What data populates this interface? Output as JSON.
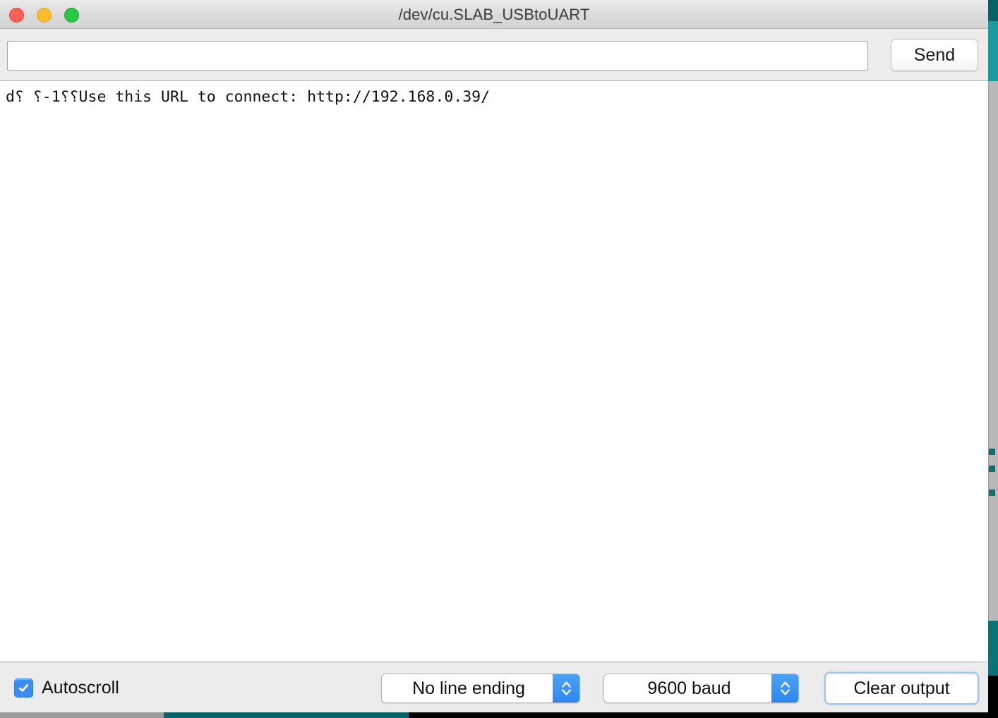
{
  "window": {
    "title": "/dev/cu.SLAB_USBtoUART",
    "traffic_lights": [
      {
        "name": "close",
        "color": "#ff5f57"
      },
      {
        "name": "minimize",
        "color": "#febc2e"
      },
      {
        "name": "maximize",
        "color": "#28c840"
      }
    ]
  },
  "send_row": {
    "input_value": "",
    "input_placeholder": "",
    "send_label": "Send"
  },
  "output": {
    "text": "d⸮ ⸮-1⸮⸮Use this URL to connect: http://192.168.0.39/"
  },
  "bottom_bar": {
    "autoscroll_label": "Autoscroll",
    "autoscroll_checked": true,
    "autoscroll_accent": "#3b8ef0",
    "line_ending_value": "No line ending",
    "baud_value": "9600 baud",
    "clear_output_label": "Clear output",
    "clear_output_focus_color": "#9fc6ef"
  },
  "desktop": {
    "teal_accent": "#1a9a9e",
    "teal_dark": "#0a6063",
    "bottom_gray": "#9a9a9a",
    "bottom_black": "#000000"
  }
}
